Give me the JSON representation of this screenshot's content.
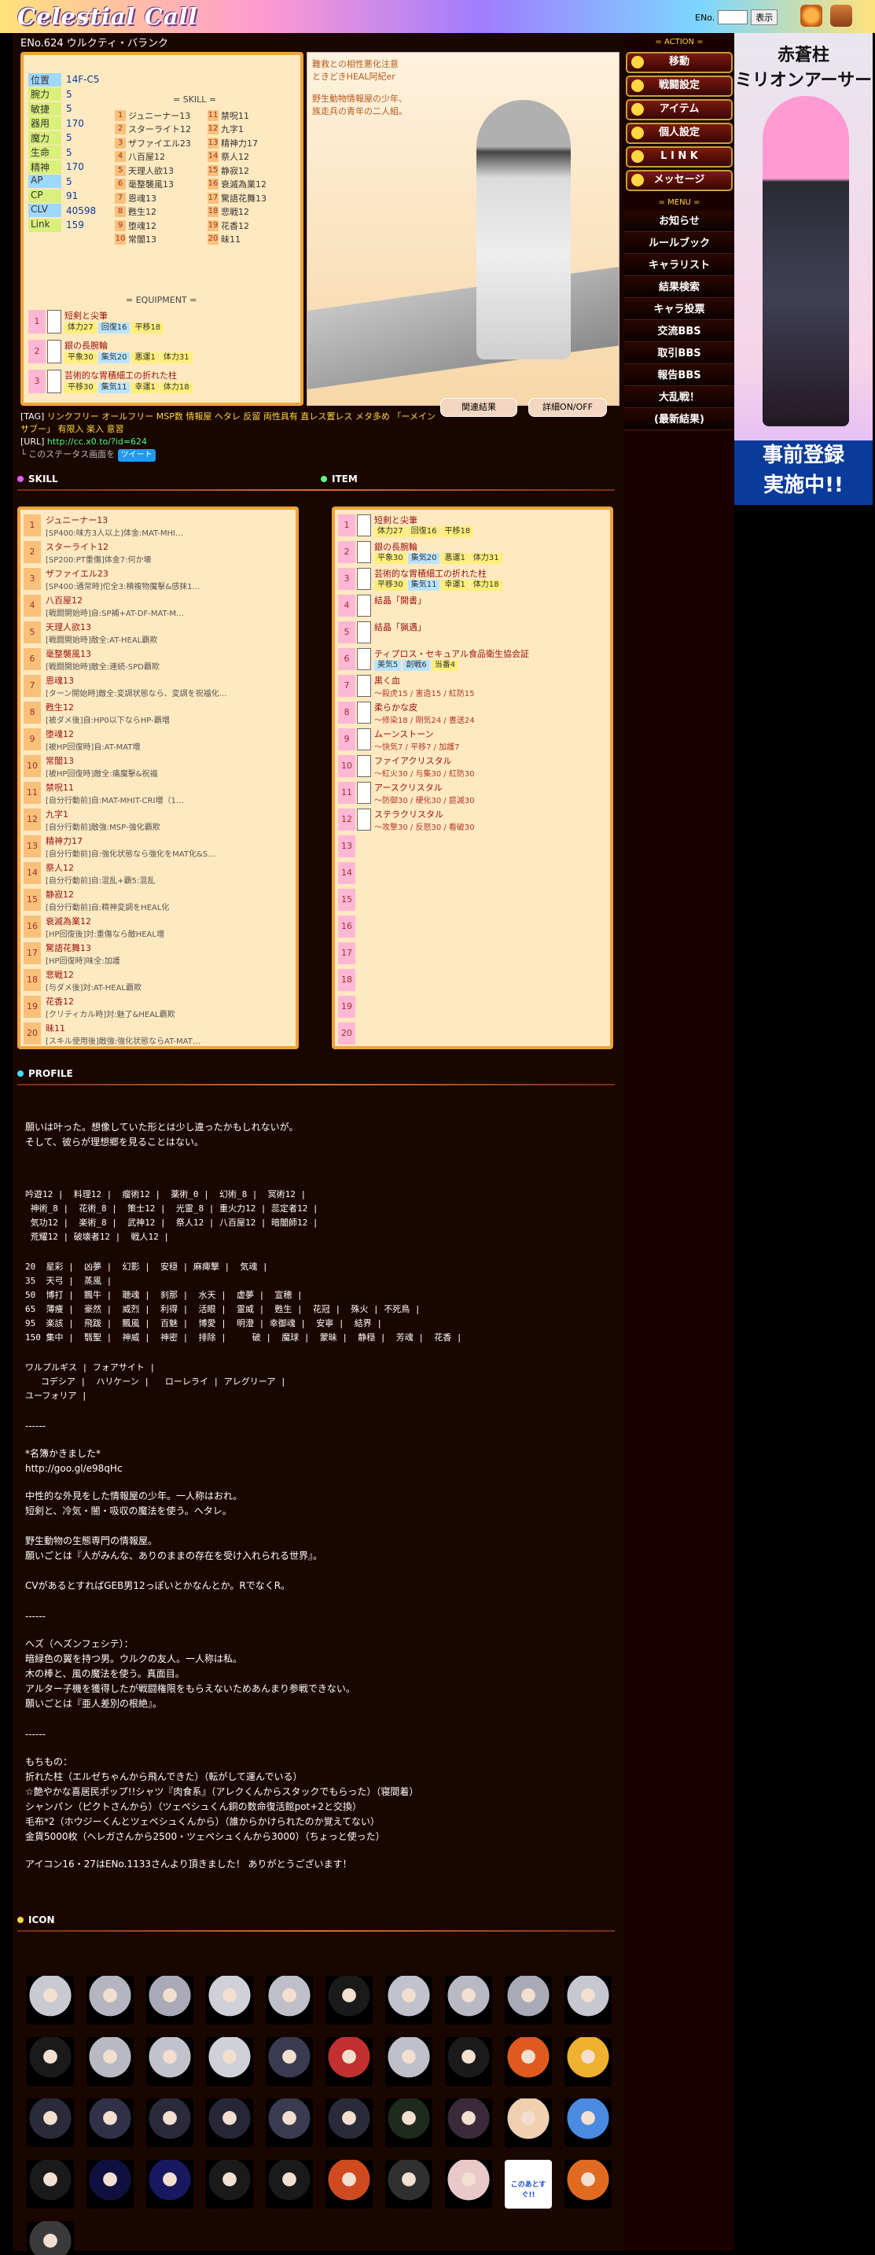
{
  "header": {
    "logo": "Celestial Call",
    "eno_label": "ENo.",
    "view_button": "表示"
  },
  "profile_name": "ENo.624 ウルクティ・バランク",
  "status": {
    "rows": [
      {
        "label": "位置",
        "value": "14F-C5"
      },
      {
        "label": "腕力",
        "value": "5"
      },
      {
        "label": "敏捷",
        "value": "5"
      },
      {
        "label": "器用",
        "value": "170"
      },
      {
        "label": "魔力",
        "value": "5"
      },
      {
        "label": "生命",
        "value": "5"
      },
      {
        "label": "精神",
        "value": "170"
      },
      {
        "label": "AP",
        "value": "5"
      },
      {
        "label": "CP",
        "value": "91"
      },
      {
        "label": "CLV",
        "value": "40598"
      },
      {
        "label": "Link",
        "value": "159"
      }
    ],
    "skill_title": "= SKILL =",
    "skills_left": [
      {
        "n": "1",
        "t": "ジュニーナー13"
      },
      {
        "n": "2",
        "t": "スターライト12"
      },
      {
        "n": "3",
        "t": "ザファイエル23"
      },
      {
        "n": "4",
        "t": "八百屋12"
      },
      {
        "n": "5",
        "t": "天理人欲13"
      },
      {
        "n": "6",
        "t": "毫整襲風13"
      },
      {
        "n": "7",
        "t": "恩魂13"
      },
      {
        "n": "8",
        "t": "甦生12"
      },
      {
        "n": "9",
        "t": "堕魂12"
      },
      {
        "n": "10",
        "t": "常闇13"
      }
    ],
    "skills_right": [
      {
        "n": "11",
        "t": "禁呪11"
      },
      {
        "n": "12",
        "t": "九字1"
      },
      {
        "n": "13",
        "t": "精神力17"
      },
      {
        "n": "14",
        "t": "祭人12"
      },
      {
        "n": "15",
        "t": "静寂12"
      },
      {
        "n": "16",
        "t": "衰滅為業12"
      },
      {
        "n": "17",
        "t": "驚語花舞13"
      },
      {
        "n": "18",
        "t": "悲戦12"
      },
      {
        "n": "19",
        "t": "花香12"
      },
      {
        "n": "20",
        "t": "昧11"
      }
    ],
    "equip_title": "= EQUIPMENT =",
    "equipment": [
      {
        "n": "1",
        "name": "短剣と尖筆",
        "s1": "体力27",
        "s2": "回復16",
        "s3": "平移18"
      },
      {
        "n": "2",
        "name": "銀の長腕輪",
        "s1": "平象30",
        "s2": "集気20",
        "s3": "悪運1",
        "s4": "体力31"
      },
      {
        "n": "3",
        "name": "芸術的な胃積細工の折れた柱",
        "s1": "平移30",
        "s2": "集気11",
        "s3": "幸運1",
        "s4": "体力18"
      }
    ]
  },
  "profile_image": {
    "caption1": "難救との相性悪化注意",
    "caption2": "ときどきHEAL阿紀er",
    "caption3": "野生動物情報屋の少年、",
    "caption4": "族走兵の青年の二人組。"
  },
  "tags": {
    "tag_label": "[TAG]",
    "tag_text": "リンクフリー オールフリー MSP数 情報屋 ヘタレ 反留 両性具有 直レス置レス メタ多め 「ーメイン サブー」 有限入 楽入 意習",
    "url_label": "[URL]",
    "url": "http://cc.x0.to/?id=624",
    "share_text": "└ このステータス画面を",
    "tweet_label": "ツイート"
  },
  "buttons": {
    "related": "関連結果",
    "detail": "詳細ON/OFF"
  },
  "sections": {
    "skill": "SKILL",
    "item": "ITEM",
    "profile": "PROFILE",
    "icon": "ICON"
  },
  "skill_list": [
    {
      "n": "1",
      "name": "ジュニーナー13",
      "desc": "[SP400:味方3人以上]体金:MAT-MHI…"
    },
    {
      "n": "2",
      "name": "スターライト12",
      "desc": "[SP200:PT重傷]体金7:何か壊"
    },
    {
      "n": "3",
      "name": "ザファイエル23",
      "desc": "[SP400:通常時]佗全3:積複物魔擊&感抹1…"
    },
    {
      "n": "4",
      "name": "八百屋12",
      "desc": "[戦闘開始時]自:SP補+AT-DF-MAT-M…"
    },
    {
      "n": "5",
      "name": "天理人欲13",
      "desc": "[戦闘開始時]敵全:AT-HEAL覇欺"
    },
    {
      "n": "6",
      "name": "毫整襲風13",
      "desc": "[戦闘開始時]敵全:連続-SPD覇欺"
    },
    {
      "n": "7",
      "name": "恩魂13",
      "desc": "[ターン開始時]敵全:変調状態なら、変調を祝福化…"
    },
    {
      "n": "8",
      "name": "甦生12",
      "desc": "[被ダメ後]自:HP0以下ならHP-覇増"
    },
    {
      "n": "9",
      "name": "堕魂12",
      "desc": "[被HP回復時]自:AT-MAT増"
    },
    {
      "n": "10",
      "name": "常闇13",
      "desc": "[被HP回復時]敵全:痛魔擊&祝福"
    },
    {
      "n": "11",
      "name": "禁呪11",
      "desc": "[自分行動前]自:MAT-MHIT-CRI増（1…"
    },
    {
      "n": "12",
      "name": "九字1",
      "desc": "[自分行動前]敵強:MSP-強化覇欺"
    },
    {
      "n": "13",
      "name": "精神力17",
      "desc": "[自分行動前]自:強化状態なら強化をMAT化&S…"
    },
    {
      "n": "14",
      "name": "祭人12",
      "desc": "[自分行動前]自:混乱+覇5:混乱"
    },
    {
      "n": "15",
      "name": "静寂12",
      "desc": "[自分行動前]自:精神変調をHEAL化"
    },
    {
      "n": "16",
      "name": "衰滅為業12",
      "desc": "[HP回復後]対:重傷なら敵HEAL増"
    },
    {
      "n": "17",
      "name": "驚語花舞13",
      "desc": "[HP回復時]味全:加護"
    },
    {
      "n": "18",
      "name": "悲戦12",
      "desc": "[与ダメ後]対:AT-HEAL覇欺"
    },
    {
      "n": "19",
      "name": "花香12",
      "desc": "[クリティカル時]対:魅了&HEAL覇欺"
    },
    {
      "n": "20",
      "name": "昧11",
      "desc": "[スキル使用後]敵強:強化状態ならAT-MAT…"
    }
  ],
  "item_list": [
    {
      "n": "1",
      "name": "短剣と尖筆",
      "stats": [
        [
          "y",
          "体力27"
        ],
        [
          "y",
          "回復16"
        ],
        [
          "y",
          "平移18"
        ]
      ]
    },
    {
      "n": "2",
      "name": "銀の長腕輪",
      "stats": [
        [
          "y",
          "平象30"
        ],
        [
          "b",
          "集気20"
        ],
        [
          "y",
          "悪運1"
        ],
        [
          "y",
          "体力31"
        ]
      ]
    },
    {
      "n": "3",
      "name": "芸術的な胃積細工の折れた柱",
      "stats": [
        [
          "y",
          "平移30"
        ],
        [
          "b",
          "集気11"
        ],
        [
          "y",
          "幸運1"
        ],
        [
          "y",
          "体力18"
        ]
      ]
    },
    {
      "n": "4",
      "name": "結晶「開書」",
      "plain": ""
    },
    {
      "n": "5",
      "name": "結晶「猟遇」",
      "plain": ""
    },
    {
      "n": "6",
      "name": "ティプロス・セキュアル食品衛生協会証",
      "stats": [
        [
          "b",
          "美気5"
        ],
        [
          "b",
          "創戦6"
        ],
        [
          "y",
          "当番4"
        ]
      ]
    },
    {
      "n": "7",
      "name": "黒く血",
      "plain": "～殺虎15 / 害造15 / 紅防15"
    },
    {
      "n": "8",
      "name": "柔らかな皮",
      "plain": "～修染18 / 剛気24 / 書送24"
    },
    {
      "n": "9",
      "name": "ムーンストーン",
      "plain": "～快気7 / 平移7 / 加護7"
    },
    {
      "n": "10",
      "name": "ファイアクリスタル",
      "plain": "～紅火30 / 与集30 / 紅防30"
    },
    {
      "n": "11",
      "name": "アースクリスタル",
      "plain": "～防御30 / 硬化30 / 庭滅30"
    },
    {
      "n": "12",
      "name": "ステラクリスタル",
      "plain": "～攻撃30 / 反怒30 / 看破30"
    },
    {
      "n": "13",
      "name": "",
      "plain": ""
    },
    {
      "n": "14",
      "name": "",
      "plain": ""
    },
    {
      "n": "15",
      "name": "",
      "plain": ""
    },
    {
      "n": "16",
      "name": "",
      "plain": ""
    },
    {
      "n": "17",
      "name": "",
      "plain": ""
    },
    {
      "n": "18",
      "name": "",
      "plain": ""
    },
    {
      "n": "19",
      "name": "",
      "plain": ""
    },
    {
      "n": "20",
      "name": "",
      "plain": ""
    }
  ],
  "profile_text": {
    "intro": "願いは叶った。想像していた形とは少し違ったかもしれないが。\nそして、彼らが理想郷を見ることはない。",
    "stats_block": "吟遊12 |  料理12 |  瘤術12 |  薬術_0 |  幻術_8 |  冥術12 |\n 神術_8 |  花術_8 |  策士12 |  光霊_8 | 重火力12 | 蕊定者12 |\n 気功12 |  楽術_8 |  武神12 |  祭人12 | 八百屋12 | 暗闇師12 |\n 荒耀12 | 破壊者12 |  戦人12 |",
    "rank_block": "20  星彩 |  凶夢 |  幻影 |  安穏 | 麻痺撃 |  気魂 |\n35  天弓 |  蒸風 |\n50  博打 |  飄牛 |  聴魂 |  刹那 |  水天 |  虚夢 |  宣穂 |\n65  薄痩 |  豪然 |  威烈 |  利得 |  活眼 |  霊威 |  甦生 |  花冠 |  殊火 | 不死鳥 |\n95  楽該 |  飛跋 |  飄風 |  百魅 |  博愛 |  明澄 | 幸御魂 |  安寧 |  結界 |\n150 集中 |  翳聖 |  神威 |  神密 |  排除 |     破 |  魔球 |  蒙昧 |  静穏 |  芳魂 |  花香 |",
    "skill_names": "ワルプルギス | フォアサイト |\n   コデシア |  ハリケーン |   ローレライ | アレグリーア |\nユーフォリア |",
    "dash1": "------",
    "credit": "*名簿かきました*\nhttp://goo.gl/e98qHc",
    "char1": "中性的な外見をした情報屋の少年。一人称はおれ。\n短剣と、冷気・闇・吸収の魔法を使う。ヘタレ。\n\n野生動物の生態専門の情報屋。\n願いごとは『人がみんな、ありのままの存在を受け入れられる世界』。\n\nCVがあるとすればGEB男12っぽいとかなんとか。RでなくR。",
    "dash2": "------",
    "char2": "ヘズ（ヘズンフェシテ）：\n暗緑色の翼を持つ男。ウルクの友人。一人称は私。\n木の棒と、風の魔法を使う。真面目。\nアルター子機を獲得したが戦闘権限をもらえないためあんまり参戦できない。\n願いごとは『亜人差別の根絶』。",
    "dash3": "------",
    "belongings": "もちもの：\n折れた柱（エルゼちゃんから飛んできた）（転がして運んでいる）\n☆艶やかな喜居民ポップ!!シャツ『肉食系』（アレクくんからスタックでもらった）（寝間着）\nシャンパン（ピクトさんから）（ツェペシュくん銅の数命復活館pot+2と交換）\n毛布*2（ホウジーくんとツェペシュくんから）（誰からかけられたのか覚えてない）\n金貨5000枚（ヘレガさんから2500・ツェペシュくんから3000）（ちょっと使った）",
    "thanks": "アイコン16・27はENo.1133さんより頂きました！ ありがとうございます！"
  },
  "icons": [
    "icon-1",
    "icon-2",
    "icon-3",
    "icon-4",
    "icon-5",
    "icon-6",
    "icon-7",
    "icon-8",
    "icon-9",
    "icon-10",
    "icon-11",
    "icon-12",
    "icon-13",
    "icon-14",
    "icon-15",
    "icon-16",
    "icon-17",
    "icon-18",
    "icon-19",
    "icon-20",
    "icon-21",
    "icon-22",
    "icon-23",
    "icon-24",
    "icon-25",
    "icon-26",
    "icon-27",
    "icon-28",
    "icon-29",
    "icon-30",
    "icon-31",
    "icon-32",
    "icon-33",
    "icon-34",
    "icon-35",
    "icon-36",
    "icon-37",
    "icon-38",
    "icon-39",
    "icon-40",
    "icon-41"
  ],
  "icon_text": "このあとすぐ!!",
  "sidebar": {
    "action_header": "= ACTION =",
    "actions": [
      "移動",
      "戦闘設定",
      "アイテム",
      "個人設定",
      "L I N K",
      "メッセージ"
    ],
    "menu_header": "= MENU =",
    "menu": [
      "お知らせ",
      "ルールブック",
      "キャラリスト",
      "結果検索",
      "キャラ投票",
      "交流BBS",
      "取引BBS",
      "報告BBS",
      "大乱戦！",
      "(最新結果)"
    ]
  },
  "ad": {
    "title": "赤蒼柱\nミリオンアーサー",
    "bottom": "事前登録\n実施中!!"
  },
  "colors": {
    "accent": "#f0a33a",
    "background": "#1a0600",
    "link_tag": "#ffd740",
    "url": "#44ff88"
  }
}
